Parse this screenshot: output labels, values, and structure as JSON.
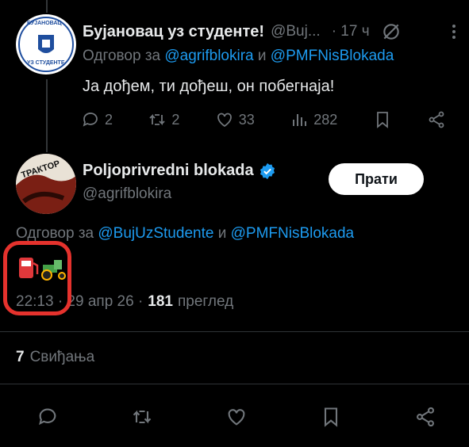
{
  "reply_tweet": {
    "display_name": "Бујановац уз студенте!",
    "handle": "@Buj...",
    "time": "· 17 ч",
    "reply_prefix": "Одговор за",
    "reply_to_1": "@agrifblokira",
    "reply_and": "и",
    "reply_to_2": "@PMFNisBlokada",
    "text": "Ја дођем, ти дођеш, он побегнаја!",
    "stats": {
      "replies": "2",
      "reposts": "2",
      "likes": "33",
      "views": "282"
    },
    "avatar_text_top": "БУЈАНОВАЦ",
    "avatar_text_bottom": "УЗ СТУДЕНТЕ"
  },
  "main_tweet": {
    "display_name": "Poljoprivredni blokada",
    "handle": "@agrifblokira",
    "follow_label": "Прати",
    "reply_prefix": "Одговор за",
    "reply_to_1": "@BujUzStudente",
    "reply_and": "и",
    "reply_to_2": "@PMFNisBlokada",
    "emoji_text": "⛽🚜",
    "time": "22:13 · 29 апр 26 ·",
    "views_count": "181",
    "views_label": "преглед",
    "likes_count": "7",
    "likes_label": "Свиђања",
    "avatar_text": "ТРАКТОР"
  },
  "colors": {
    "accent": "#1d9bf0",
    "highlight": "#e5322d",
    "background": "#000000"
  }
}
